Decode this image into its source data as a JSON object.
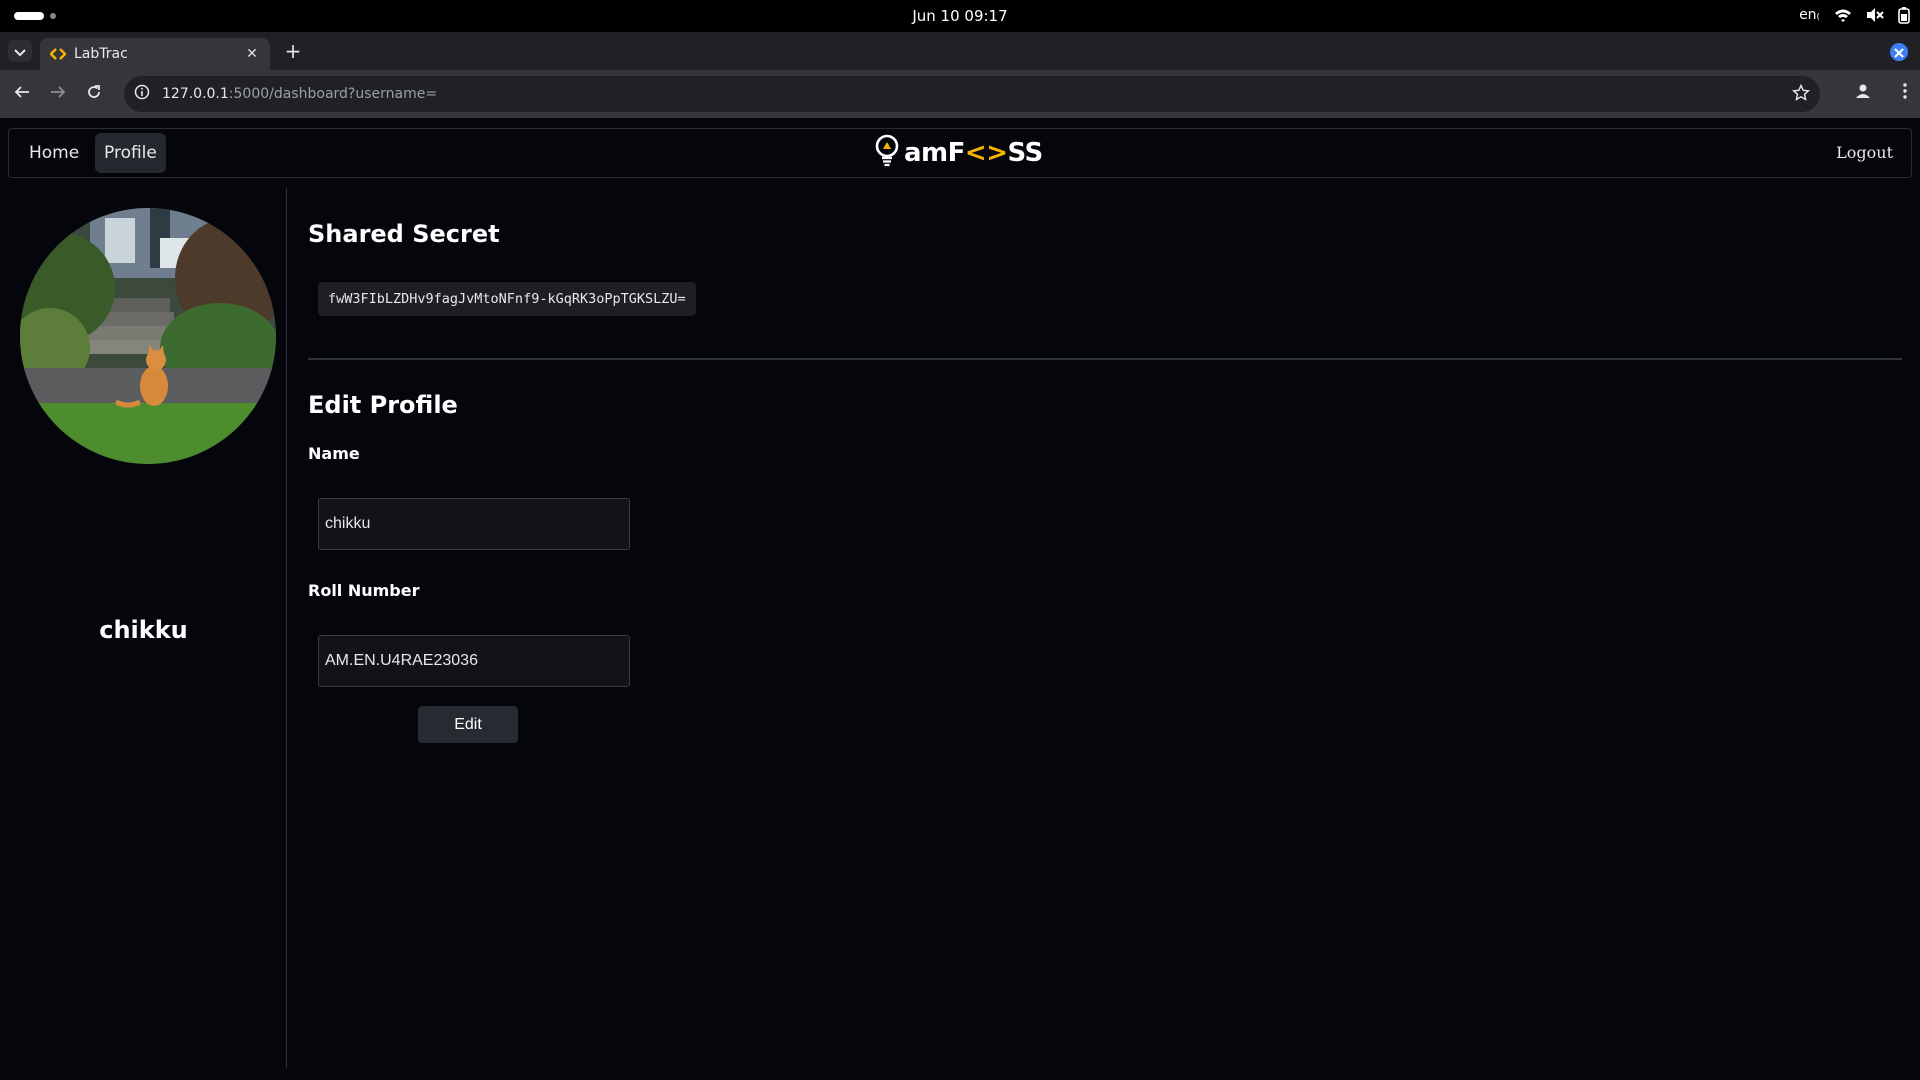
{
  "system_bar": {
    "clock": "Jun 10  09:17",
    "keyboard_layout": "en₍"
  },
  "browser": {
    "tab": {
      "title": "LabTrac"
    },
    "address": {
      "host": "127.0.0.1",
      "rest": ":5000/dashboard?username="
    }
  },
  "navbar": {
    "home": "Home",
    "profile": "Profile",
    "brand_left": "amF",
    "brand_accent": "<>",
    "brand_right": "SS",
    "logout": "Logout"
  },
  "sidebar": {
    "username": "chikku"
  },
  "main": {
    "shared_secret_heading": "Shared Secret",
    "shared_secret_value": "fwW3FIbLZDHv9fagJvMtoNFnf9-kGqRK3oPpTGKSLZU=",
    "edit_profile_heading": "Edit Profile",
    "name_label": "Name",
    "name_value": "chikku",
    "roll_label": "Roll Number",
    "roll_value": "AM.EN.U4RAE23036",
    "edit_button": "Edit"
  },
  "colors": {
    "brand_accent": "#f5b400",
    "page_background": "#05060b",
    "browser_accent": "#3d7ef5"
  }
}
